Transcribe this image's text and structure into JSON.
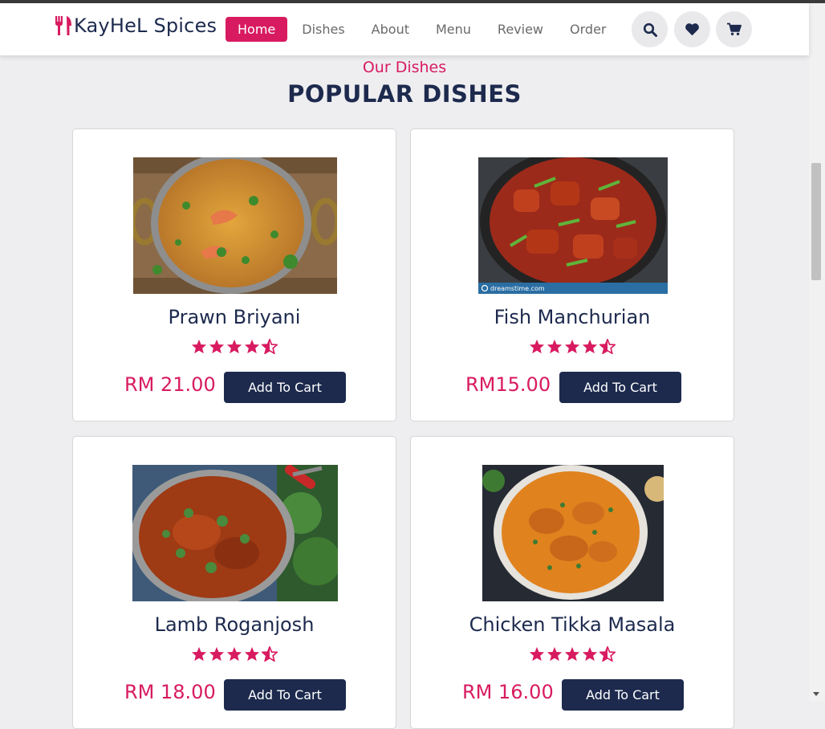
{
  "brand": {
    "name": "KayHeL Spices"
  },
  "nav": {
    "items": [
      "Home",
      "Dishes",
      "About",
      "Menu",
      "Review",
      "Order"
    ],
    "active": "Home"
  },
  "header_icons": [
    "search-icon",
    "heart-icon",
    "cart-icon"
  ],
  "section": {
    "subtitle": "Our Dishes",
    "title": "POPULAR DISHES"
  },
  "dishes": [
    {
      "name": "Prawn Briyani",
      "price": "RM 21.00",
      "rating": 4.5,
      "button": "Add To Cart"
    },
    {
      "name": "Fish Manchurian",
      "price": "RM15.00",
      "rating": 4.5,
      "button": "Add To Cart"
    },
    {
      "name": "Lamb Roganjosh",
      "price": "RM 18.00",
      "rating": 4.5,
      "button": "Add To Cart"
    },
    {
      "name": "Chicken Tikka Masala",
      "price": "RM 16.00",
      "rating": 4.5,
      "button": "Add To Cart"
    }
  ],
  "image_watermark": "dreamstime.com",
  "colors": {
    "accent": "#d81b60",
    "navy": "#1d2a4e",
    "background": "#eeeef0"
  }
}
